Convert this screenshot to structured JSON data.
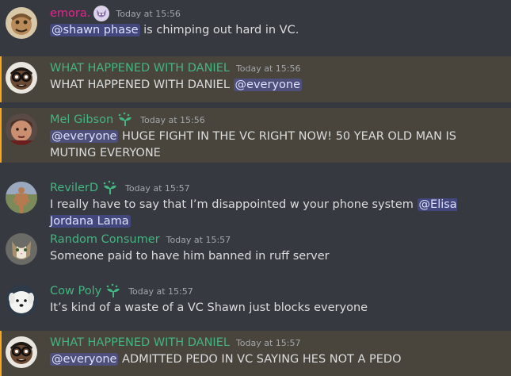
{
  "messages": [
    {
      "username": "emora.",
      "username_color": "#e8238e",
      "badge": "wolf-emoji-icon",
      "timestamp": "Today at 15:56",
      "highlighted": false,
      "parts": [
        {
          "type": "mention",
          "text": "@shawn phase"
        },
        {
          "type": "text",
          "text": " is chimping out hard in VC."
        }
      ]
    },
    {
      "username": "WHAT HAPPENED WITH DANIEL",
      "username_color": "#43b581",
      "badge": null,
      "timestamp": "Today at 15:56",
      "highlighted": true,
      "parts": [
        {
          "type": "text",
          "text": "WHAT HAPPENED WITH DANIEL "
        },
        {
          "type": "mention",
          "text": "@everyone"
        }
      ]
    },
    {
      "username": "Mel Gibson",
      "username_color": "#43b581",
      "badge": "nitro-sprout-icon",
      "timestamp": "Today at 15:56",
      "highlighted": true,
      "parts": [
        {
          "type": "mention",
          "text": "@everyone"
        },
        {
          "type": "text",
          "text": " HUGE FIGHT IN THE VC RIGHT NOW! 50 YEAR OLD MAN IS MUTING EVERYONE"
        }
      ]
    },
    {
      "username": "RevilerD",
      "username_color": "#43b581",
      "badge": "nitro-sprout-icon",
      "timestamp": "Today at 15:57",
      "highlighted": false,
      "parts": [
        {
          "type": "text",
          "text": "I really have to say that I’m disappointed w your phone system "
        },
        {
          "type": "mention",
          "text": "@Elisa Jordana Lama"
        }
      ]
    },
    {
      "username": "Random Consumer",
      "username_color": "#43b581",
      "badge": null,
      "timestamp": "Today at 15:57",
      "highlighted": false,
      "parts": [
        {
          "type": "text",
          "text": "Someone paid to have him banned in ruff server"
        }
      ]
    },
    {
      "username": "Cow Poly",
      "username_color": "#43b581",
      "badge": "nitro-sprout-icon",
      "timestamp": "Today at 15:57",
      "highlighted": false,
      "parts": [
        {
          "type": "text",
          "text": "It’s kind of a waste of a VC Shawn just blocks everyone"
        }
      ]
    },
    {
      "username": "WHAT HAPPENED WITH DANIEL",
      "username_color": "#43b581",
      "badge": null,
      "timestamp": "Today at 15:57",
      "highlighted": true,
      "parts": [
        {
          "type": "mention",
          "text": "@everyone"
        },
        {
          "type": "text",
          "text": " ADMITTED PEDO IN VC SAYING HES NOT A PEDO"
        }
      ]
    }
  ]
}
